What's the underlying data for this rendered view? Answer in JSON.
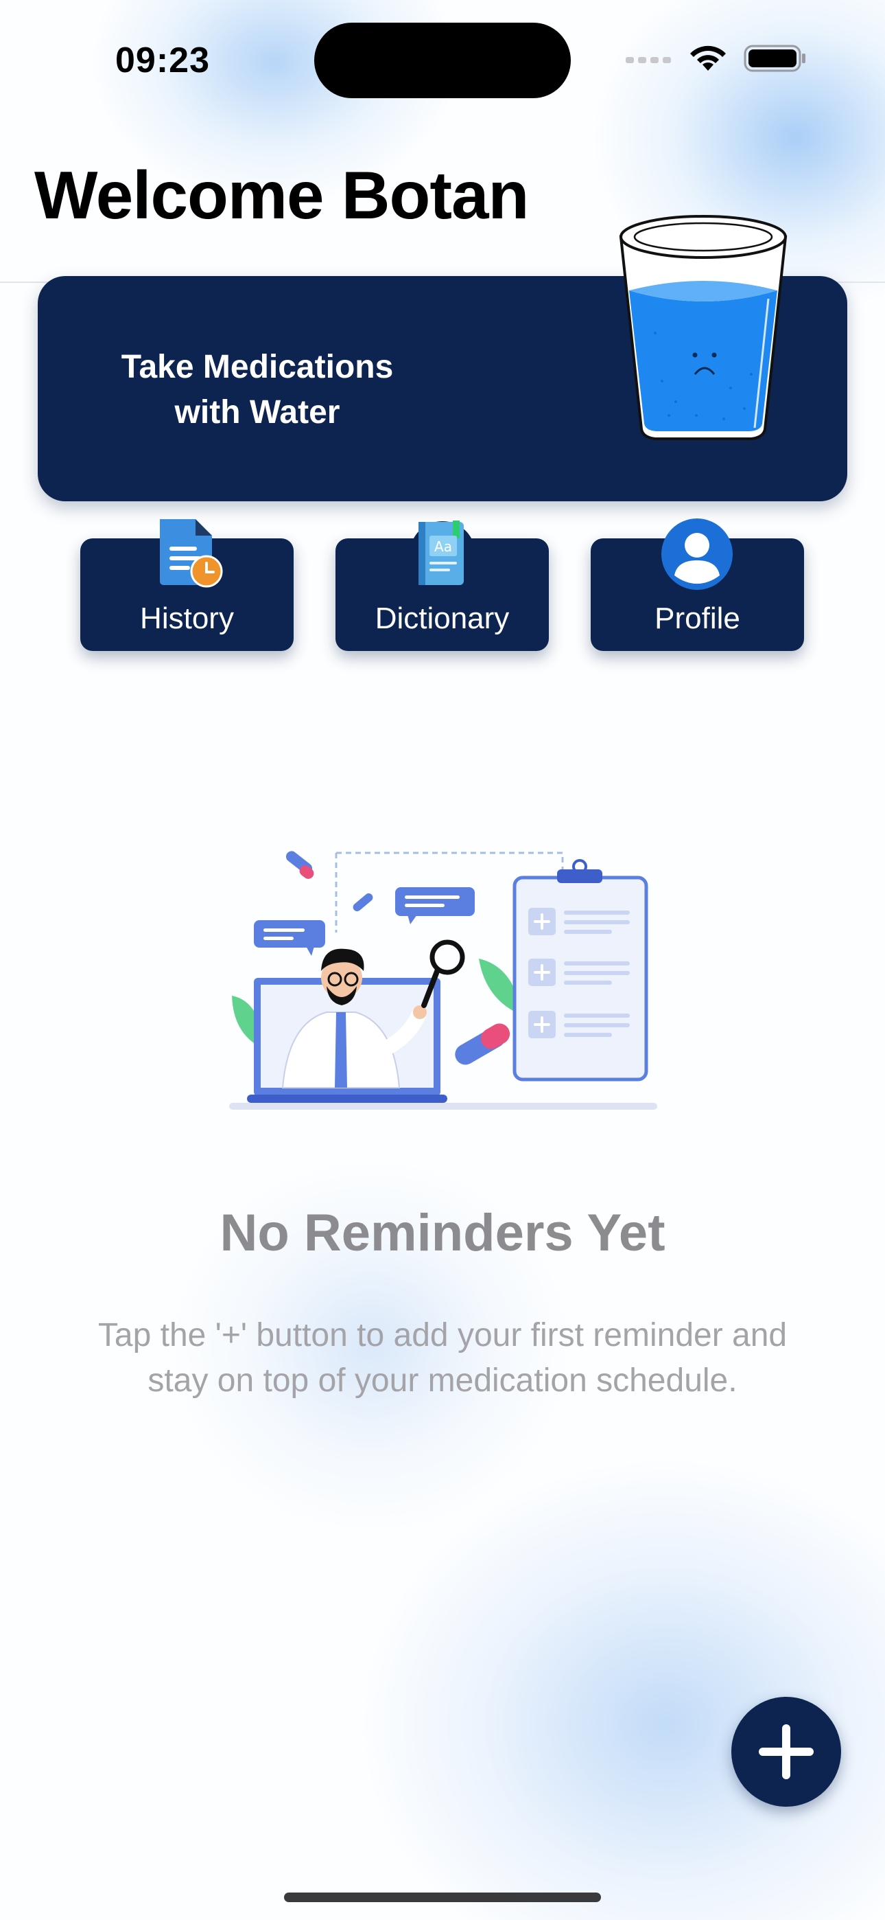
{
  "status_bar": {
    "time": "09:23"
  },
  "header": {
    "title": "Welcome Botan"
  },
  "banner": {
    "text": "Take Medications\nwith Water"
  },
  "quick_actions": [
    {
      "label": "History",
      "icon": "history-document-clock-icon"
    },
    {
      "label": "Dictionary",
      "icon": "dictionary-book-icon"
    },
    {
      "label": "Profile",
      "icon": "profile-user-icon"
    }
  ],
  "empty_state": {
    "title": "No Reminders Yet",
    "subtitle": "Tap the '+' button to add your first reminder and stay on top of your medication schedule."
  },
  "fab": {
    "icon": "plus-icon"
  },
  "colors": {
    "navy": "#0c244f",
    "water_blue": "#1e88f0",
    "illustration_blue": "#5b7fe0",
    "muted_text": "#8c8c90"
  }
}
